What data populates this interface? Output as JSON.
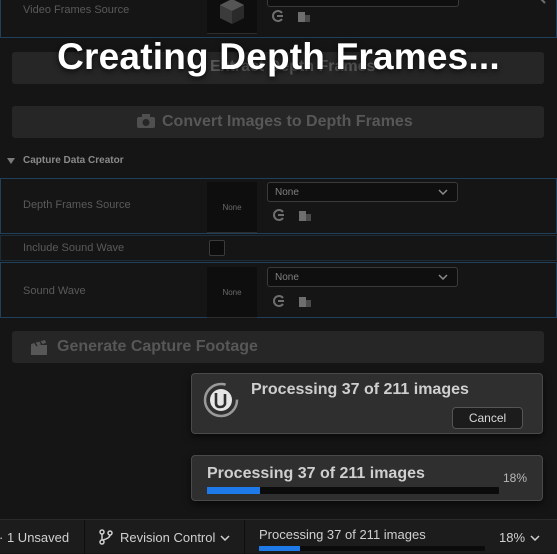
{
  "overlay": {
    "title": "Creating Depth Frames..."
  },
  "video_frames": {
    "label": "Video Frames Source"
  },
  "buttons": {
    "extract_label": "Extract Depth Frames",
    "convert_label": "Convert Images to Depth Frames",
    "generate_label": "Generate Capture Footage"
  },
  "capture_creator": {
    "section_title": "Capture Data Creator",
    "depth_label": "Depth Frames Source",
    "depth_thumb": "None",
    "depth_combo": "None",
    "sound_toggle_label": "Include Sound Wave",
    "sound_toggle_checked": false,
    "sound_label": "Sound Wave",
    "sound_thumb": "None",
    "sound_combo": "None"
  },
  "notification": {
    "message": "Processing 37 of 211 images",
    "cancel_label": "Cancel"
  },
  "progress_toast": {
    "message": "Processing 37 of 211 images",
    "percent_label": "18%",
    "progress": 0.18
  },
  "statusbar": {
    "unsaved": "1 Unsaved",
    "revision": "Revision Control",
    "task": "Processing 37 of 211 images",
    "percent": "18%",
    "progress": 0.18
  },
  "colors": {
    "accent": "#1e7ae8",
    "row_border": "#1f3f5a"
  },
  "icons": [
    "cube-asset-icon",
    "reset-arrow-icon",
    "browse-folder-icon",
    "chevron-down-icon",
    "camera-icon",
    "clapperboard-icon",
    "unreal-logo-icon",
    "branch-icon"
  ]
}
